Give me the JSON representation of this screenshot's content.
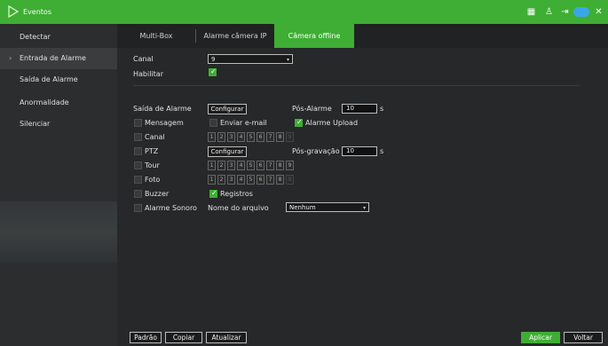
{
  "header": {
    "title": "Eventos"
  },
  "sidebar": {
    "items": [
      {
        "label": "Detectar"
      },
      {
        "label": "Entrada de Alarme",
        "arrow": "›"
      },
      {
        "label": "Saída de Alarme"
      },
      {
        "label": "Anormalidade"
      },
      {
        "label": "Silenciar"
      }
    ]
  },
  "tabs": [
    {
      "label": "Multi-Box"
    },
    {
      "label": "Alarme câmera IP"
    },
    {
      "label": "Câmera offline"
    }
  ],
  "form": {
    "canal_label": "Canal",
    "canal_value": "9",
    "habilitar_label": "Habilitar",
    "saida_alarme_label": "Saída de Alarme",
    "configurar_label": "Configurar",
    "pos_alarme_label": "Pós-Alarme",
    "pos_alarme_value": "10",
    "pos_alarme_unit": "s",
    "mensagem_label": "Mensagem",
    "enviar_email_label": "Enviar e-mail",
    "alarme_upload_label": "Alarme Upload",
    "canal2_label": "Canal",
    "ptz_label": "PTZ",
    "ptz_configurar_label": "Configurar",
    "pos_gravacao_label": "Pós-gravação",
    "pos_gravacao_value": "10",
    "pos_gravacao_unit": "s",
    "tour_label": "Tour",
    "foto_label": "Foto",
    "buzzer_label": "Buzzer",
    "registros_label": "Registros",
    "alarme_sonoro_label": "Alarme Sonoro",
    "nome_arquivo_label": "Nome do arquivo",
    "nome_arquivo_value": "Nenhum",
    "channels": [
      "1",
      "2",
      "3",
      "4",
      "5",
      "6",
      "7",
      "8",
      "9"
    ]
  },
  "footer": {
    "padrao": "Padrão",
    "copiar": "Copiar",
    "atualizar": "Atualizar",
    "aplicar": "Aplicar",
    "voltar": "Voltar"
  },
  "colors": {
    "accent": "#3fae34"
  }
}
